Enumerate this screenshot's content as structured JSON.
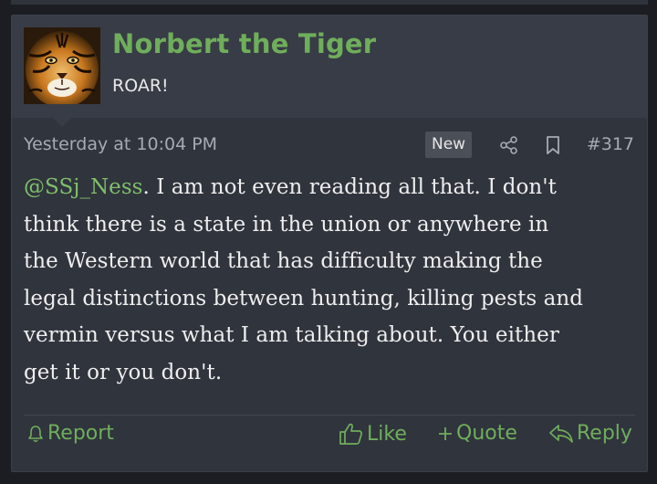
{
  "post": {
    "username": "Norbert the Tiger",
    "user_title": "ROAR!",
    "date": "Yesterday at 10:04 PM",
    "badge": "New",
    "post_number": "#317",
    "mention": "@SSj_Ness",
    "message_lines": [
      ". I am not even reading all that. I don't",
      "think there is a state in the union or anywhere in",
      "the Western world that has difficulty making the",
      "legal distinctions between hunting, killing pests and",
      "vermin versus what I am talking about. You either",
      "get it or you don't."
    ],
    "icons": {
      "share": "share-icon",
      "bookmark": "bookmark-icon",
      "report": "bell-icon",
      "like": "thumbs-up-icon",
      "quote": "plus-icon",
      "reply": "reply-arrow-icon"
    }
  },
  "actions": {
    "report": "Report",
    "like": "Like",
    "quote": "Quote",
    "reply": "Reply"
  },
  "colors": {
    "accent_green": "#6fae5b",
    "background": "#30343d",
    "user_block": "#383c46"
  }
}
